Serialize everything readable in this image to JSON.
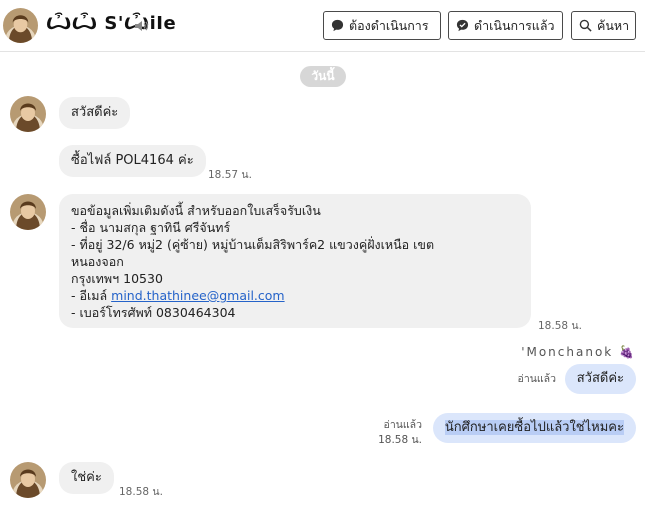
{
  "header": {
    "name": "ѼѼ S'ѼiIe",
    "buttons": {
      "todo": "ต้องดำเนินการ",
      "done": "ดำเนินการแล้ว",
      "search": "ค้นหา"
    }
  },
  "date_chip": "วันนี้",
  "messages": {
    "m1": {
      "text": "สวัสดีค่ะ"
    },
    "m2": {
      "text": "ซื้อไฟล์ POL4164 ค่ะ",
      "time": "18.57 น."
    },
    "m3": {
      "lines": [
        "ขอข้อมูลเพิ่มเติมดังนี้ สำหรับออกใบเสร็จรับเงิน",
        "- ชื่อ นามสกุล ฐาทินี ศรีจันทร์",
        "- ที่อยู่ 32/6  หมู่2   (คู่ซ้าย) หมู่บ้านเต็มสิริพาร์ค2  แขวงคู่ฝั่งเหนือ   เขต",
        "หนองจอก",
        "กรุงเทพฯ 10530"
      ],
      "email_prefix": "- อีเมล์ ",
      "email": "mind.thathinee@gmail.com",
      "phone": "- เบอร์โทรศัพท์  0830464304",
      "time": "18.58 น."
    },
    "out_sender": "'Monchanok 🍇",
    "o1": {
      "text": "สวัสดีค่ะ",
      "status": "อ่านแล้ว"
    },
    "o2": {
      "text": "นักศึกษาเคยซื้อไปแล้วใช่ไหมคะ",
      "status": "อ่านแล้ว",
      "time": "18.58 น."
    },
    "m4": {
      "text": "ใช่ค่ะ",
      "time": "18.58 น."
    }
  },
  "icons": {
    "sound": "speaker-icon",
    "todo": "chat-bubble-icon",
    "done": "chat-check-icon",
    "search": "search-icon"
  }
}
